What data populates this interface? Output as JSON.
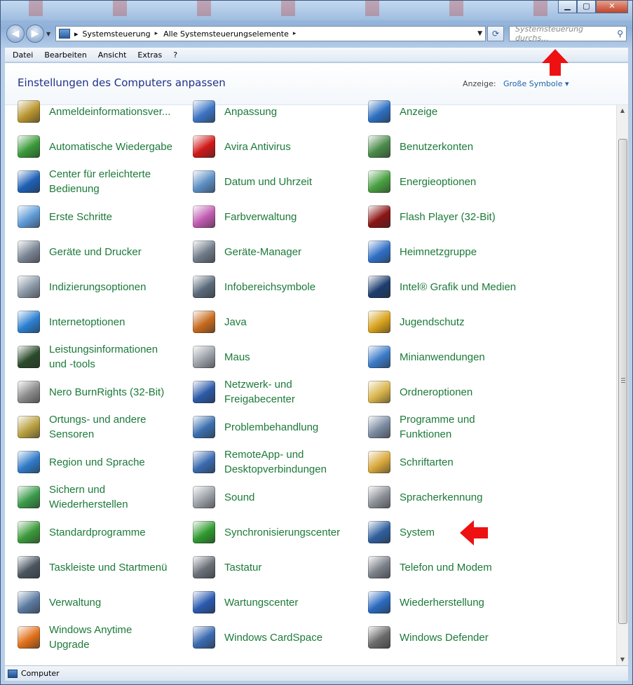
{
  "window": {
    "buttons": {
      "minimize": "▁",
      "maximize": "▢",
      "close": "✕"
    }
  },
  "address": {
    "crumbs": [
      "Systemsteuerung",
      "Alle Systemsteuerungselemente"
    ],
    "separator": "▸"
  },
  "search": {
    "placeholder": "Systemsteuerung durchs..."
  },
  "menu": [
    "Datei",
    "Bearbeiten",
    "Ansicht",
    "Extras",
    "?"
  ],
  "header": {
    "title": "Einstellungen des Computers anpassen",
    "view_label": "Anzeige:",
    "view_value": "Große Symbole"
  },
  "items": [
    {
      "label": "Anmeldeinformationsver...",
      "icon": "vault-icon",
      "color": "#b9952f"
    },
    {
      "label": "Anpassung",
      "icon": "personalization-icon",
      "color": "#3b74c4"
    },
    {
      "label": "Anzeige",
      "icon": "display-icon",
      "color": "#2d6fc1"
    },
    {
      "label": "Automatische Wiedergabe",
      "icon": "autoplay-icon",
      "color": "#3a9a3a"
    },
    {
      "label": "Avira Antivirus",
      "icon": "avira-icon",
      "color": "#d01818"
    },
    {
      "label": "Benutzerkonten",
      "icon": "users-icon",
      "color": "#4a8a4a"
    },
    {
      "label": "Center für erleichterte\nBedienung",
      "icon": "ease-of-access-icon",
      "color": "#1d5fb6"
    },
    {
      "label": "Datum und Uhrzeit",
      "icon": "calendar-clock-icon",
      "color": "#5c8fc4"
    },
    {
      "label": "Energieoptionen",
      "icon": "battery-icon",
      "color": "#48a040"
    },
    {
      "label": "Erste Schritte",
      "icon": "getting-started-icon",
      "color": "#5e9ad6"
    },
    {
      "label": "Farbverwaltung",
      "icon": "color-management-icon",
      "color": "#c05ab0"
    },
    {
      "label": "Flash Player (32-Bit)",
      "icon": "flash-icon",
      "color": "#8a1414"
    },
    {
      "label": "Geräte und Drucker",
      "icon": "printer-icon",
      "color": "#7a8594"
    },
    {
      "label": "Geräte-Manager",
      "icon": "device-manager-icon",
      "color": "#6f7b88"
    },
    {
      "label": "Heimnetzgruppe",
      "icon": "homegroup-icon",
      "color": "#2f6fc6"
    },
    {
      "label": "Indizierungsoptionen",
      "icon": "indexing-icon",
      "color": "#8a97a6"
    },
    {
      "label": "Infobereichsymbole",
      "icon": "notification-area-icon",
      "color": "#5a6a7a"
    },
    {
      "label": "Intel® Grafik und Medien",
      "icon": "intel-graphics-icon",
      "color": "#1d3d6e"
    },
    {
      "label": "Internetoptionen",
      "icon": "internet-options-icon",
      "color": "#2a7fd0"
    },
    {
      "label": "Java",
      "icon": "java-icon",
      "color": "#c76a1d"
    },
    {
      "label": "Jugendschutz",
      "icon": "parental-controls-icon",
      "color": "#d8a21a"
    },
    {
      "label": "Leistungsinformationen\nund -tools",
      "icon": "performance-icon",
      "color": "#2a4a2a"
    },
    {
      "label": "Maus",
      "icon": "mouse-icon",
      "color": "#9aa0a8"
    },
    {
      "label": "Minianwendungen",
      "icon": "gadgets-icon",
      "color": "#3a7ac8"
    },
    {
      "label": "Nero BurnRights (32-Bit)",
      "icon": "nero-icon",
      "color": "#8a8a8a"
    },
    {
      "label": "Netzwerk- und\nFreigabecenter",
      "icon": "network-icon",
      "color": "#2b5aa8"
    },
    {
      "label": "Ordneroptionen",
      "icon": "folder-options-icon",
      "color": "#d8b44a"
    },
    {
      "label": "Ortungs- und andere\nSensoren",
      "icon": "location-sensor-icon",
      "color": "#b8a040"
    },
    {
      "label": "Problembehandlung",
      "icon": "troubleshooting-icon",
      "color": "#3a6fae"
    },
    {
      "label": "Programme und\nFunktionen",
      "icon": "programs-icon",
      "color": "#7a8aa0"
    },
    {
      "label": "Region und Sprache",
      "icon": "region-globe-icon",
      "color": "#2f7ac8"
    },
    {
      "label": "RemoteApp- und\nDesktopverbindungen",
      "icon": "remoteapp-icon",
      "color": "#3a6ab0"
    },
    {
      "label": "Schriftarten",
      "icon": "fonts-icon",
      "color": "#d8a83a"
    },
    {
      "label": "Sichern und\nWiederherstellen",
      "icon": "backup-icon",
      "color": "#3a9a4a"
    },
    {
      "label": "Sound",
      "icon": "speaker-icon",
      "color": "#9aa0a6"
    },
    {
      "label": "Spracherkennung",
      "icon": "microphone-icon",
      "color": "#8a8f96"
    },
    {
      "label": "Standardprogramme",
      "icon": "default-programs-icon",
      "color": "#3a9a3a"
    },
    {
      "label": "Synchronisierungscenter",
      "icon": "sync-center-icon",
      "color": "#2f9a2f"
    },
    {
      "label": "System",
      "icon": "system-icon",
      "color": "#2f5f9e"
    },
    {
      "label": "Taskleiste und Startmenü",
      "icon": "taskbar-icon",
      "color": "#4a5560"
    },
    {
      "label": "Tastatur",
      "icon": "keyboard-icon",
      "color": "#6a7078"
    },
    {
      "label": "Telefon und Modem",
      "icon": "phone-modem-icon",
      "color": "#7a8088"
    },
    {
      "label": "Verwaltung",
      "icon": "administrative-tools-icon",
      "color": "#5a7aa0"
    },
    {
      "label": "Wartungscenter",
      "icon": "action-center-flag-icon",
      "color": "#2a5ab0"
    },
    {
      "label": "Wiederherstellung",
      "icon": "recovery-icon",
      "color": "#2a6ac0"
    },
    {
      "label": "Windows Anytime\nUpgrade",
      "icon": "windows-logo-icon",
      "color": "#e0701a"
    },
    {
      "label": "Windows CardSpace",
      "icon": "cardspace-icon",
      "color": "#3a6ab0"
    },
    {
      "label": "Windows Defender",
      "icon": "defender-icon",
      "color": "#6a6a6a"
    }
  ],
  "statusbar": {
    "label": "Computer"
  }
}
